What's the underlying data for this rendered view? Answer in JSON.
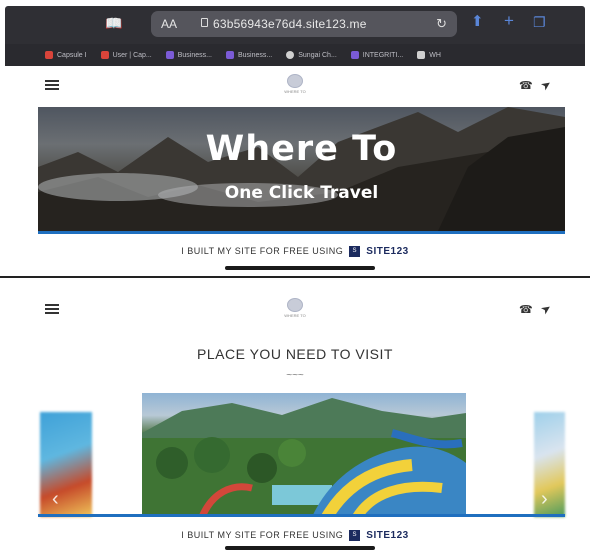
{
  "browser": {
    "text_size_label": "AA",
    "url": "63b56943e76d4.site123.me",
    "tabs": [
      {
        "label": "Capsule I",
        "color": "#d9443a"
      },
      {
        "label": "User | Cap...",
        "color": "#d9443a"
      },
      {
        "label": "Business...",
        "color": "#7b5bd6"
      },
      {
        "label": "Business...",
        "color": "#7b5bd6"
      },
      {
        "label": "Sungai Ch...",
        "color": "#d0d0d0"
      },
      {
        "label": "INTEGRITI...",
        "color": "#7b5bd6"
      },
      {
        "label": "WH",
        "color": "#d0d0d0"
      }
    ]
  },
  "site": {
    "logo_text": "WHERE TO",
    "hero": {
      "title": "Where To",
      "subtitle": "One Click Travel"
    },
    "section_title": "PLACE YOU NEED TO VISIT",
    "section_separator": "~~~",
    "footer": {
      "text": "I BUILT MY SITE FOR FREE USING",
      "badge": "S",
      "brand": "SITE123"
    }
  },
  "icons": {
    "hamburger": "hamburger-icon",
    "phone": "phone-icon",
    "location": "location-arrow-icon",
    "reload": "reload-icon",
    "book": "book-icon",
    "share": "share-icon",
    "plus": "plus-icon",
    "tabs": "tabs-icon"
  },
  "colors": {
    "accent": "#1f6fbf",
    "brand_dark": "#1b2a5e",
    "chrome_bg": "#2f2f34"
  }
}
